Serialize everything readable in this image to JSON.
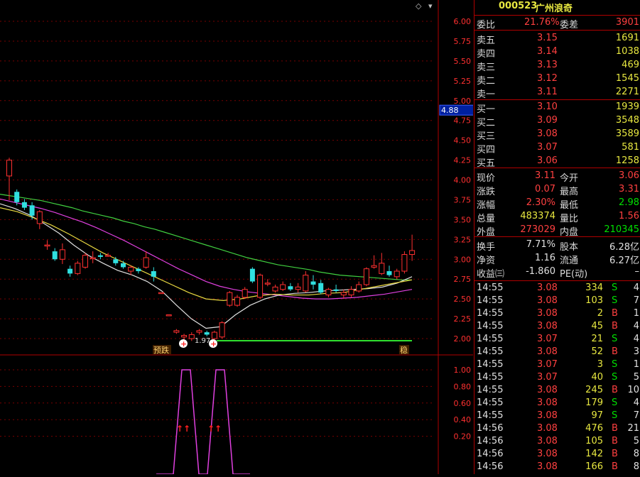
{
  "header": {
    "code": "000523",
    "name": "广州浪奇"
  },
  "price_axis": [
    "6.00",
    "5.75",
    "5.50",
    "5.25",
    "5.00",
    "4.75",
    "4.50",
    "4.25",
    "4.00",
    "3.75",
    "3.50",
    "3.25",
    "3.00",
    "2.75",
    "2.50",
    "2.25",
    "2.00"
  ],
  "current_price_tag": "4.88",
  "indicator_axis": [
    "1.00",
    "0.80",
    "0.60",
    "0.40",
    "0.20"
  ],
  "chart_labels": {
    "low_label": "1.97",
    "tag_yudie": "预跌",
    "tag_wen": "稳"
  },
  "order_book": {
    "weibi_label": "委比",
    "weibi_value": "21.76%",
    "weicha_label": "委差",
    "weicha_value": "3901",
    "asks": [
      {
        "label": "卖五",
        "price": "3.15",
        "vol": "1691"
      },
      {
        "label": "卖四",
        "price": "3.14",
        "vol": "1038"
      },
      {
        "label": "卖三",
        "price": "3.13",
        "vol": "469"
      },
      {
        "label": "卖二",
        "price": "3.12",
        "vol": "1545"
      },
      {
        "label": "卖一",
        "price": "3.11",
        "vol": "2271"
      }
    ],
    "bids": [
      {
        "label": "买一",
        "price": "3.10",
        "vol": "1939"
      },
      {
        "label": "买二",
        "price": "3.09",
        "vol": "3548"
      },
      {
        "label": "买三",
        "price": "3.08",
        "vol": "3589"
      },
      {
        "label": "买四",
        "price": "3.07",
        "vol": "581"
      },
      {
        "label": "买五",
        "price": "3.06",
        "vol": "1258"
      }
    ]
  },
  "quote": [
    {
      "l1": "现价",
      "v1": "3.11",
      "c1": "red",
      "l2": "今开",
      "v2": "3.06",
      "c2": "red"
    },
    {
      "l1": "涨跌",
      "v1": "0.07",
      "c1": "red",
      "l2": "最高",
      "v2": "3.31",
      "c2": "red"
    },
    {
      "l1": "涨幅",
      "v1": "2.30%",
      "c1": "red",
      "l2": "最低",
      "v2": "2.98",
      "c2": "grn"
    },
    {
      "l1": "总量",
      "v1": "483374",
      "c1": "yel",
      "l2": "量比",
      "v2": "1.56",
      "c2": "red"
    },
    {
      "l1": "外盘",
      "v1": "273029",
      "c1": "red",
      "l2": "内盘",
      "v2": "210345",
      "c2": "grn"
    }
  ],
  "fundamentals": [
    {
      "l1": "换手",
      "v1": "7.71%",
      "l2": "股本",
      "v2": "6.28亿"
    },
    {
      "l1": "净资",
      "v1": "1.16",
      "l2": "流通",
      "v2": "6.27亿"
    },
    {
      "l1": "收益㈢",
      "v1": "-1.860",
      "l2": "PE(动)",
      "v2": "–"
    }
  ],
  "ticks": [
    {
      "t": "14:55",
      "p": "3.08",
      "v": "334",
      "s": "S",
      "n": "4"
    },
    {
      "t": "14:55",
      "p": "3.08",
      "v": "103",
      "s": "S",
      "n": "7"
    },
    {
      "t": "14:55",
      "p": "3.08",
      "v": "2",
      "s": "B",
      "n": "1"
    },
    {
      "t": "14:55",
      "p": "3.08",
      "v": "45",
      "s": "B",
      "n": "4"
    },
    {
      "t": "14:55",
      "p": "3.07",
      "v": "21",
      "s": "S",
      "n": "4"
    },
    {
      "t": "14:55",
      "p": "3.08",
      "v": "52",
      "s": "B",
      "n": "3"
    },
    {
      "t": "14:55",
      "p": "3.07",
      "v": "3",
      "s": "S",
      "n": "1"
    },
    {
      "t": "14:55",
      "p": "3.07",
      "v": "40",
      "s": "S",
      "n": "5"
    },
    {
      "t": "14:55",
      "p": "3.08",
      "v": "245",
      "s": "B",
      "n": "10"
    },
    {
      "t": "14:55",
      "p": "3.08",
      "v": "179",
      "s": "S",
      "n": "4"
    },
    {
      "t": "14:55",
      "p": "3.08",
      "v": "97",
      "s": "S",
      "n": "7"
    },
    {
      "t": "14:56",
      "p": "3.08",
      "v": "476",
      "s": "B",
      "n": "21"
    },
    {
      "t": "14:56",
      "p": "3.08",
      "v": "105",
      "s": "B",
      "n": "5"
    },
    {
      "t": "14:56",
      "p": "3.08",
      "v": "142",
      "s": "B",
      "n": "8"
    },
    {
      "t": "14:56",
      "p": "3.08",
      "v": "166",
      "s": "B",
      "n": "8"
    }
  ],
  "candles": [
    [
      4.05,
      4.25,
      3.75,
      4.28
    ],
    [
      3.85,
      3.72,
      3.68,
      3.88
    ],
    [
      3.72,
      3.65,
      3.62,
      3.76
    ],
    [
      3.68,
      3.55,
      3.5,
      3.72
    ],
    [
      3.45,
      3.6,
      3.38,
      3.62
    ],
    [
      3.18,
      3.18,
      3.12,
      3.24
    ],
    [
      3.1,
      3.0,
      2.98,
      3.14
    ],
    [
      3.0,
      3.12,
      2.94,
      3.2
    ],
    [
      2.88,
      2.82,
      2.78,
      2.92
    ],
    [
      2.82,
      2.95,
      2.8,
      2.98
    ],
    [
      2.9,
      3.05,
      2.88,
      3.08
    ],
    [
      3.02,
      3.02,
      2.95,
      3.1
    ],
    [
      3.05,
      3.03,
      3.0,
      3.08
    ],
    [
      3.05,
      3.05,
      3.03,
      3.08
    ],
    [
      3.0,
      2.95,
      2.92,
      3.03
    ],
    [
      2.95,
      2.9,
      2.88,
      2.98
    ],
    [
      2.85,
      2.9,
      2.8,
      2.92
    ],
    [
      2.88,
      2.85,
      2.82,
      2.9
    ],
    [
      2.9,
      3.02,
      2.88,
      3.1
    ],
    [
      2.85,
      2.78,
      2.72,
      2.9
    ],
    [
      2.58,
      2.58,
      2.58,
      2.58
    ],
    [
      2.3,
      2.3,
      2.3,
      2.3
    ],
    [
      2.08,
      2.1,
      2.06,
      2.12
    ],
    [
      2.02,
      2.04,
      1.98,
      2.06
    ],
    [
      2.0,
      2.05,
      1.97,
      2.08
    ],
    [
      2.08,
      2.1,
      2.05,
      2.12
    ],
    [
      2.08,
      2.05,
      2.03,
      2.1
    ],
    [
      2.0,
      2.08,
      1.98,
      2.1
    ],
    [
      2.02,
      2.2,
      2.0,
      2.22
    ],
    [
      2.42,
      2.58,
      2.4,
      2.6
    ],
    [
      2.42,
      2.52,
      2.4,
      2.55
    ],
    [
      2.52,
      2.62,
      2.5,
      2.65
    ],
    [
      2.88,
      2.72,
      2.7,
      2.9
    ],
    [
      2.52,
      2.8,
      2.5,
      2.82
    ],
    [
      2.7,
      2.7,
      2.66,
      2.75
    ],
    [
      2.6,
      2.65,
      2.58,
      2.68
    ],
    [
      2.62,
      2.68,
      2.6,
      2.72
    ],
    [
      2.66,
      2.62,
      2.6,
      2.7
    ],
    [
      2.62,
      2.65,
      2.58,
      2.7
    ],
    [
      2.6,
      2.8,
      2.58,
      2.85
    ],
    [
      2.72,
      2.68,
      2.62,
      2.8
    ],
    [
      2.7,
      2.58,
      2.56,
      2.74
    ],
    [
      2.55,
      2.62,
      2.52,
      2.64
    ],
    [
      2.62,
      2.6,
      2.58,
      2.68
    ],
    [
      2.55,
      2.58,
      2.5,
      2.62
    ],
    [
      2.55,
      2.62,
      2.52,
      2.66
    ],
    [
      2.6,
      2.68,
      2.58,
      2.72
    ],
    [
      2.68,
      2.88,
      2.66,
      2.9
    ],
    [
      2.9,
      2.92,
      2.88,
      3.05
    ],
    [
      2.82,
      2.95,
      2.8,
      3.08
    ],
    [
      2.85,
      2.8,
      2.78,
      2.92
    ],
    [
      2.78,
      2.85,
      2.75,
      2.88
    ],
    [
      2.85,
      3.06,
      2.82,
      3.1
    ],
    [
      3.06,
      3.11,
      2.98,
      3.31
    ]
  ],
  "ma": {
    "green": [
      3.82,
      3.8,
      3.78,
      3.76,
      3.74,
      3.71,
      3.68,
      3.65,
      3.61,
      3.58,
      3.55,
      3.52,
      3.48,
      3.45,
      3.41,
      3.38,
      3.34,
      3.3,
      3.26,
      3.22,
      3.18,
      3.14,
      3.1,
      3.06,
      3.02,
      2.99,
      2.96,
      2.93,
      2.91,
      2.89,
      2.87,
      2.84,
      2.82,
      2.8,
      2.79,
      2.78,
      2.77,
      2.76,
      2.75,
      2.74,
      2.74
    ],
    "magenta": [
      3.76,
      3.72,
      3.68,
      3.64,
      3.59,
      3.53,
      3.47,
      3.4,
      3.32,
      3.24,
      3.15,
      3.06,
      2.97,
      2.88,
      2.8,
      2.72,
      2.66,
      2.62,
      2.59,
      2.57,
      2.55,
      2.53,
      2.51,
      2.5,
      2.5,
      2.51,
      2.52,
      2.54,
      2.56,
      2.59,
      2.62
    ],
    "white": [
      3.7,
      3.64,
      3.56,
      3.45,
      3.33,
      3.18,
      3.05,
      2.95,
      2.86,
      2.8,
      2.72,
      2.6,
      2.42,
      2.25,
      2.13,
      2.15,
      2.3,
      2.42,
      2.5,
      2.55,
      2.57,
      2.58,
      2.6,
      2.61,
      2.62,
      2.63,
      2.65,
      2.7,
      2.78
    ],
    "yellow": [
      3.65,
      3.6,
      3.52,
      3.43,
      3.32,
      3.2,
      3.08,
      2.98,
      2.88,
      2.78,
      2.68,
      2.58,
      2.5,
      2.48,
      2.5,
      2.54,
      2.56,
      2.55,
      2.55,
      2.57,
      2.58,
      2.62,
      2.66,
      2.7,
      2.74
    ]
  },
  "support_level": 2.0,
  "indicator": [
    0,
    0,
    0,
    1,
    1,
    0,
    0,
    1,
    1,
    0,
    0,
    0
  ]
}
